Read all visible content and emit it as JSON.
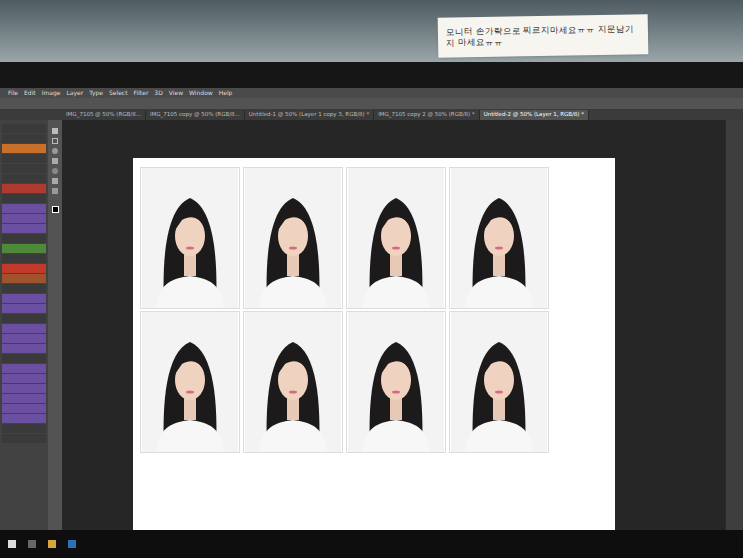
{
  "note": "모니터 손가락으로 찌르지마세요ㅠㅠ 지문남기지 마세요ㅠㅠ",
  "menu": [
    "File",
    "Edit",
    "Image",
    "Layer",
    "Type",
    "Select",
    "Filter",
    "3D",
    "View",
    "Window",
    "Help"
  ],
  "tabs": [
    {
      "label": "IMG_7105 @ 50% (RGB/8...",
      "selected": false
    },
    {
      "label": "IMG_7105 copy @ 50% (RGB/8...",
      "selected": false
    },
    {
      "label": "Untitled-1 @ 50% (Layer 1 copy 3, RGB/8) *",
      "selected": false
    },
    {
      "label": "IMG_7105 copy 2 @ 50% (RGB/8) *",
      "selected": false
    },
    {
      "label": "Untitled-2 @ 50% (Layer 1, RGB/8) *",
      "selected": true
    }
  ],
  "panel_rows": [
    {
      "color": "#3a3a3a"
    },
    {
      "color": "#3a3a3a"
    },
    {
      "color": "#c8702a"
    },
    {
      "color": "#3a3a3a"
    },
    {
      "color": "#3a3a3a"
    },
    {
      "color": "#3a3a3a"
    },
    {
      "color": "#b03a2e"
    },
    {
      "color": "#3a3a3a"
    },
    {
      "color": "#6b4fa0"
    },
    {
      "color": "#6b4fa0"
    },
    {
      "color": "#6b4fa0"
    },
    {
      "color": "#3a3a3a"
    },
    {
      "color": "#4f8a3a"
    },
    {
      "color": "#3a3a3a"
    },
    {
      "color": "#c0392b"
    },
    {
      "color": "#a0522d"
    },
    {
      "color": "#3a3a3a"
    },
    {
      "color": "#6b4fa0"
    },
    {
      "color": "#6b4fa0"
    },
    {
      "color": "#3a3a3a"
    },
    {
      "color": "#6b4fa0"
    },
    {
      "color": "#6b4fa0"
    },
    {
      "color": "#6b4fa0"
    },
    {
      "color": "#3a3a3a"
    },
    {
      "color": "#6b4fa0"
    },
    {
      "color": "#6b4fa0"
    },
    {
      "color": "#6b4fa0"
    },
    {
      "color": "#6b4fa0"
    },
    {
      "color": "#6b4fa0"
    },
    {
      "color": "#6b4fa0"
    },
    {
      "color": "#3a3a3a"
    },
    {
      "color": "#3a3a3a"
    }
  ]
}
